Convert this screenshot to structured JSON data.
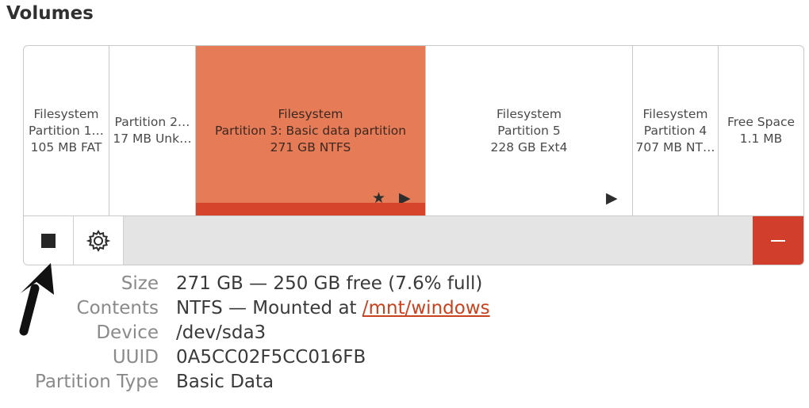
{
  "title": "Volumes",
  "partitions": [
    {
      "line1": "Filesystem",
      "line2": "Partition 1…",
      "line3": "105 MB FAT",
      "selected": false
    },
    {
      "line1": "",
      "line2": "Partition 2…",
      "line3": "17 MB Unk…",
      "selected": false
    },
    {
      "line1": "Filesystem",
      "line2": "Partition 3: Basic data partition",
      "line3": "271 GB NTFS",
      "selected": true
    },
    {
      "line1": "Filesystem",
      "line2": "Partition 5",
      "line3": "228 GB Ext4",
      "selected": false
    },
    {
      "line1": "Filesystem",
      "line2": "Partition 4",
      "line3": "707 MB NT…",
      "selected": false
    },
    {
      "line1": "",
      "line2": "Free Space",
      "line3": "1.1 MB",
      "selected": false
    }
  ],
  "icons": {
    "star": "star-icon",
    "play": "play-icon",
    "stop": "stop-icon",
    "gear": "gear-icon",
    "minus": "minus-icon",
    "arrow": "arrow-icon"
  },
  "colors": {
    "selected_partition": "#e57c57",
    "selected_bar": "#d6452b",
    "delete_button": "#d13e2c",
    "link": "#c8421e"
  },
  "details": {
    "size_label": "Size",
    "size_value": "271 GB — 250 GB free (7.6% full)",
    "contents_label": "Contents",
    "contents_prefix": "NTFS — Mounted at ",
    "contents_link": "/mnt/windows",
    "device_label": "Device",
    "device_value": "/dev/sda3",
    "uuid_label": "UUID",
    "uuid_value": "0A5CC02F5CC016FB",
    "ptype_label": "Partition Type",
    "ptype_value": "Basic Data"
  }
}
